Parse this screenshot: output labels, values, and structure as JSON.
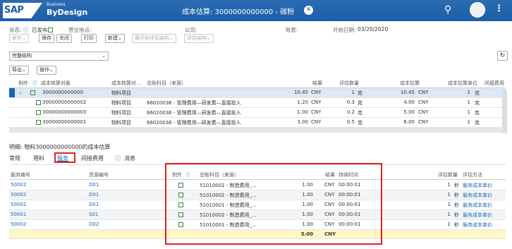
{
  "header": {
    "brand1": "SAP",
    "brand2": "Business",
    "brand3": "ByDesign",
    "title": "成本估算: 3000000000000 - 碳粉"
  },
  "info": {
    "status_label": "状态:",
    "released": "已发布",
    "plant_label": "营业地点:",
    "company_label": "公司:",
    "account_label": "账套:",
    "start_label": "开始日期:",
    "start_date": "03/20/2020"
  },
  "toolbar": {
    "release": "发布",
    "save": "保存",
    "close": "关闭",
    "print": "打印",
    "new": "新建",
    "expand": "展开和评估结构",
    "eval": "评估结构"
  },
  "structure_select": "完整结构",
  "export": "导出",
  "action": "操作",
  "t1": {
    "headers": [
      "例外",
      "成本核算对象",
      "成本核算对...",
      "总账科目（来源）",
      "结果",
      "评估数量",
      "成本估算",
      "成本估算单位",
      "间接费用"
    ],
    "rows": [
      {
        "obj": "3000000000000",
        "type": "物料项目",
        "gl": "",
        "result": "10.45",
        "cur": "CNY",
        "qty": "1",
        "unit": "克",
        "est": "10.45",
        "ecur": "CNY",
        "eunit": "1",
        "eu": "克"
      },
      {
        "obj": "30000000000002",
        "type": "物料项目",
        "gl": "66020036 - 管理费用—研发费—直接投入",
        "result": "1.20",
        "cur": "CNY",
        "qty": "0.3",
        "unit": "克",
        "est": "4.00",
        "ecur": "CNY",
        "eunit": "1",
        "eu": "克"
      },
      {
        "obj": "30000000000003",
        "type": "物料项目",
        "gl": "66020036 - 管理费用—研发费—直接投入",
        "result": "1.00",
        "cur": "CNY",
        "qty": "0.2",
        "unit": "克",
        "est": "5.00",
        "ecur": "CNY",
        "eunit": "1",
        "eu": "克"
      },
      {
        "obj": "30000000000001",
        "type": "物料项目",
        "gl": "66020036 - 管理费用—研发费—直接投入",
        "result": "3.00",
        "cur": "CNY",
        "qty": "0.5",
        "unit": "克",
        "est": "6.00",
        "ecur": "CNY",
        "eunit": "1",
        "eu": "克"
      }
    ]
  },
  "detail": {
    "title": "明细: 物料3000000000000的成本估算",
    "tabs": [
      "常规",
      "用料",
      "服务",
      "间接费用",
      "消息"
    ]
  },
  "t2": {
    "headers": [
      "服务编号",
      "资源编号",
      "例外",
      "总账科目（来源）",
      "结果",
      "持续时间",
      "评估数量",
      "评估方法"
    ],
    "rows": [
      {
        "svc": "50002",
        "res": "D01",
        "gl": "51010001 - 制造费用_...",
        "result": "1.00",
        "cur": "CNY",
        "dur": "00:00:01",
        "qty": "1",
        "u": "秒",
        "method": "服务成本单价"
      },
      {
        "svc": "50002",
        "res": "D01",
        "gl": "51010002 - 制造费用_...",
        "result": "1.00",
        "cur": "CNY",
        "dur": "00:00:01",
        "qty": "1",
        "u": "秒",
        "method": "服务成本单价"
      },
      {
        "svc": "50002",
        "res": "D01",
        "gl": "51010001 - 制造费用_...",
        "result": "1.00",
        "cur": "CNY",
        "dur": "00:00:01",
        "qty": "1",
        "u": "秒",
        "method": "服务成本单价"
      },
      {
        "svc": "50001",
        "res": "S01",
        "gl": "51010002 - 制造费用_...",
        "result": "1.00",
        "cur": "CNY",
        "dur": "00:00:01",
        "qty": "1",
        "u": "秒",
        "method": "服务成本单价"
      },
      {
        "svc": "50002",
        "res": "D02",
        "gl": "51010001 - 制造费用_...",
        "result": "1.00",
        "cur": "CNY",
        "dur": "00:00:01",
        "qty": "1",
        "u": "秒",
        "method": "服务成本单价"
      }
    ],
    "total": "5.00",
    "total_cur": "CNY"
  }
}
